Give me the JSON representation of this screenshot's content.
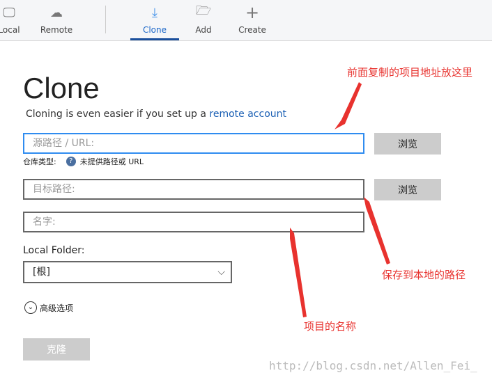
{
  "toolbar": {
    "items": [
      {
        "label": "Local",
        "icon": "monitor-icon"
      },
      {
        "label": "Remote",
        "icon": "cloud-icon"
      },
      {
        "label": "Clone",
        "icon": "download-icon"
      },
      {
        "label": "Add",
        "icon": "folder-open-icon"
      },
      {
        "label": "Create",
        "icon": "plus-icon"
      }
    ],
    "active": "Clone"
  },
  "form": {
    "title": "Clone",
    "subtitle": "Cloning is even easier if you set up a ",
    "subtitle_link": "remote account",
    "source_placeholder": "源路径 / URL:",
    "repo_type_label": "仓库类型:",
    "repo_type_value": "未提供路径或 URL",
    "dest_placeholder": "目标路径:",
    "name_placeholder": "名字:",
    "browse1": "浏览",
    "browse2": "浏览",
    "local_folder_label": "Local Folder:",
    "local_folder_value": "[根]",
    "advanced": "高级选项",
    "clone_button": "克隆"
  },
  "annotations": {
    "a1": "前面复制的项目地址放这里",
    "a2": "保存到本地的路径",
    "a3": "项目的名称",
    "color": "#e8322e"
  },
  "watermark": "http://blog.csdn.net/Allen_Fei_"
}
